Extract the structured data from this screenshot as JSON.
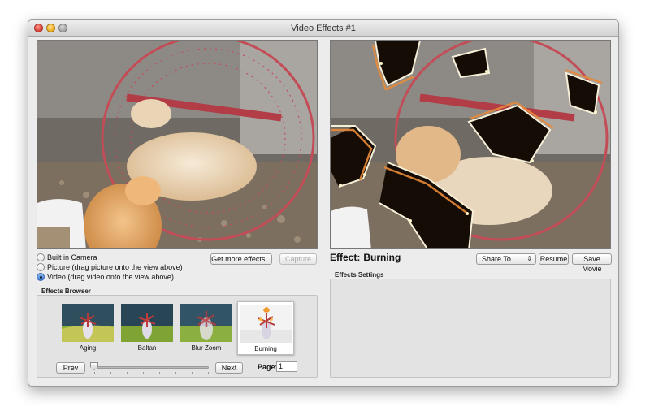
{
  "window": {
    "title": "Video Effects #1"
  },
  "source": {
    "options": [
      {
        "label": "Built in Camera",
        "selected": false
      },
      {
        "label": "Picture (drag picture onto the view above)",
        "selected": false
      },
      {
        "label": "Video (drag video onto the view above)",
        "selected": true
      }
    ],
    "get_more_effects_label": "Get more effects...",
    "capture_label": "Capture"
  },
  "effect": {
    "prefix": "Effect:",
    "name": "Burning"
  },
  "share": {
    "label": "Share To...",
    "options_visible": [
      "Share To..."
    ]
  },
  "buttons": {
    "resume": "Resume",
    "save_movie": "Save Movie"
  },
  "effects_browser": {
    "title": "Effects Browser",
    "items": [
      {
        "label": "Aging",
        "selected": false
      },
      {
        "label": "Baltan",
        "selected": false
      },
      {
        "label": "Blur Zoom",
        "selected": false
      },
      {
        "label": "Burning",
        "selected": true
      }
    ],
    "prev_label": "Prev",
    "next_label": "Next",
    "page_label": "Page:",
    "page_value": "1"
  },
  "effects_settings": {
    "title": "Effects Settings"
  },
  "colors": {
    "accent": "#3f7bd0",
    "window_bg": "#ececec"
  }
}
